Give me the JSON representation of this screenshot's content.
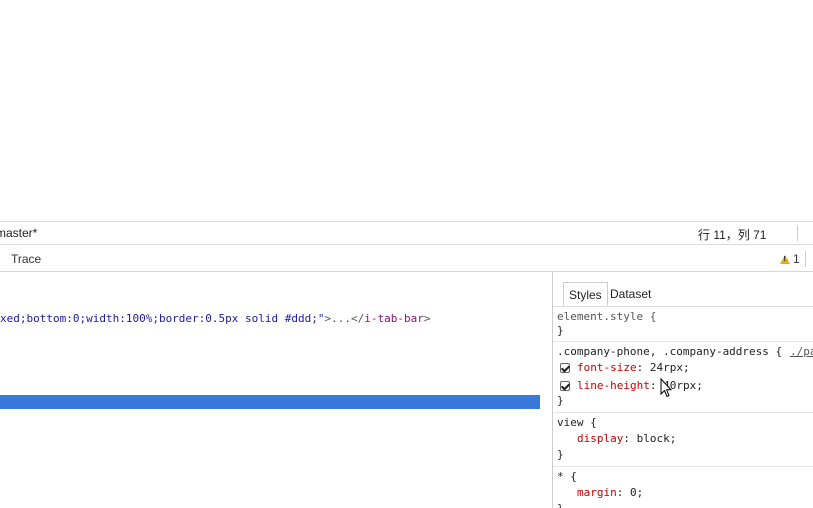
{
  "statusbar": {
    "branch": "master*",
    "cursor_position": "行 11，列 71"
  },
  "devtools": {
    "trace_tab": "Trace",
    "warning_count": "1"
  },
  "elements": {
    "line_attr": "xed;bottom:0;width:100%;border:0.5px solid #ddd;\"",
    "line_ellipsis": ">...</",
    "line_tag": "i-tab-bar",
    "line_close": ">"
  },
  "styles": {
    "tabs": [
      "Styles",
      "Dataset"
    ],
    "element_style": "element.style {",
    "close_brace": "}",
    "rule1_selector": ".company-phone, .company-address {",
    "rule1_source": "./pa",
    "rule1_prop1_name": "font-size",
    "rule1_prop1_value": ": 24rpx;",
    "rule1_prop2_name": "line-height",
    "rule1_prop2_value": ": 40rpx;",
    "rule2_selector": "view {",
    "rule2_prop_name": "display",
    "rule2_prop_value": ": block;",
    "rule3_selector": "* {",
    "rule3_prop_name": "margin",
    "rule3_prop_value": ": 0;"
  },
  "colors": {
    "selection": "#3879d9",
    "property_name": "#c80000",
    "tag": "#881280",
    "warning": "#e6b000"
  }
}
